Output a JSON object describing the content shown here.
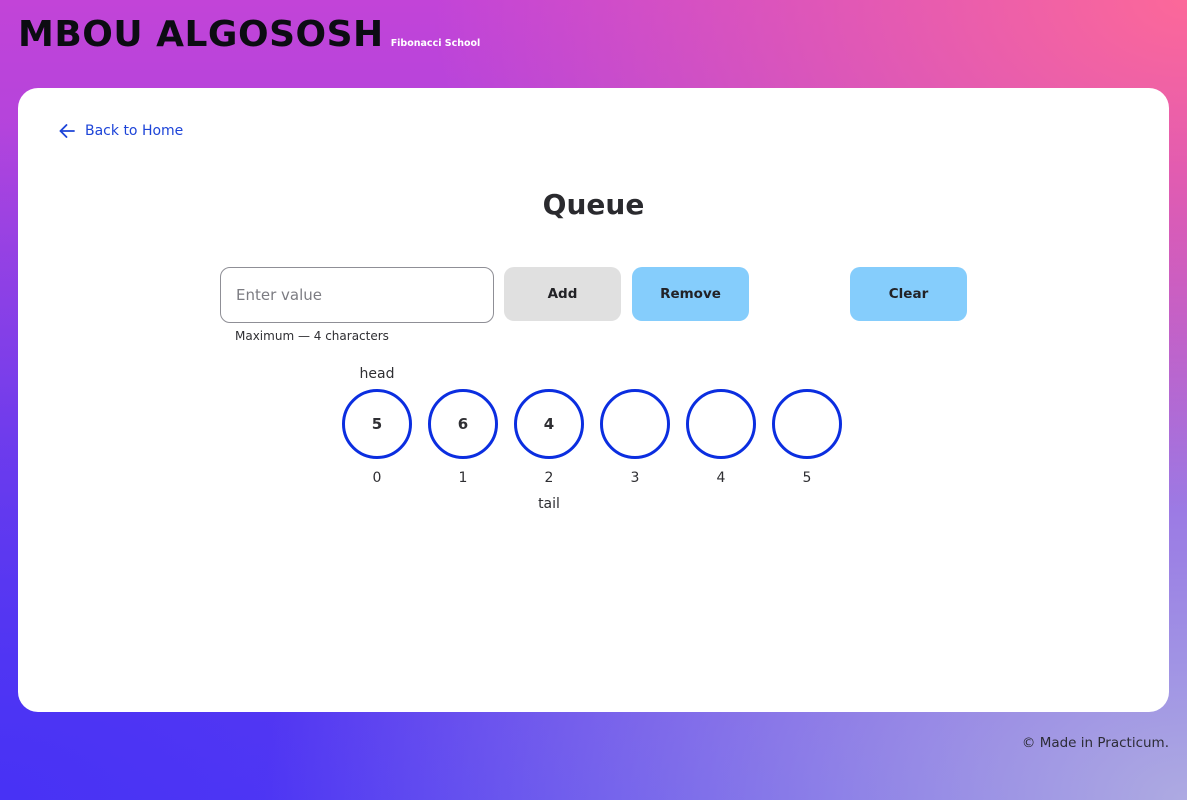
{
  "header": {
    "title": "MBOU ALGOSOSH",
    "subtitle": "Fibonacci School"
  },
  "nav": {
    "back_label": "Back to Home"
  },
  "page": {
    "title": "Queue"
  },
  "form": {
    "input_value": "",
    "input_placeholder": "Enter value",
    "hint": "Maximum — 4 characters",
    "add_label": "Add",
    "remove_label": "Remove",
    "clear_label": "Clear"
  },
  "queue": {
    "slots": [
      {
        "value": "5",
        "index": "0",
        "head": "head",
        "tail": ""
      },
      {
        "value": "6",
        "index": "1",
        "head": "",
        "tail": ""
      },
      {
        "value": "4",
        "index": "2",
        "head": "",
        "tail": "tail"
      },
      {
        "value": "",
        "index": "3",
        "head": "",
        "tail": ""
      },
      {
        "value": "",
        "index": "4",
        "head": "",
        "tail": ""
      },
      {
        "value": "",
        "index": "5",
        "head": "",
        "tail": ""
      }
    ]
  },
  "footer": {
    "text": "© Made in Practicum."
  },
  "colors": {
    "accent": "#0b2ee0",
    "link": "#1d44d8",
    "button_primary": "#85cdfc",
    "button_secondary": "#e0e0e0"
  },
  "icons": {
    "back": "arrow-left-icon"
  }
}
